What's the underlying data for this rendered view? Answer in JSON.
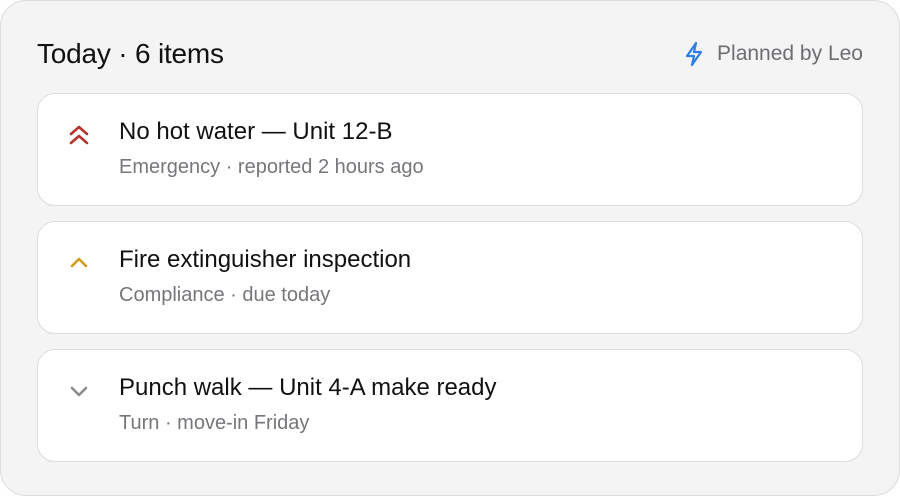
{
  "header": {
    "title": "Today · 6 items",
    "planned_by": "Planned by Leo"
  },
  "items": [
    {
      "title": "No hot water — Unit 12-B",
      "meta": "Emergency · reported 2 hours ago",
      "priority_icon": "double-chevron-up-icon",
      "priority_color": "#b3342b"
    },
    {
      "title": "Fire extinguisher inspection",
      "meta": "Compliance · due today",
      "priority_icon": "chevron-up-icon",
      "priority_color": "#d09a1f"
    },
    {
      "title": "Punch walk — Unit 4-A make ready",
      "meta": "Turn · move-in Friday",
      "priority_icon": "chevron-down-icon",
      "priority_color": "#8c8c90"
    }
  ],
  "colors": {
    "accent": "#2f7ee6",
    "panel_bg": "#f4f4f5",
    "card_bg": "#ffffff"
  }
}
